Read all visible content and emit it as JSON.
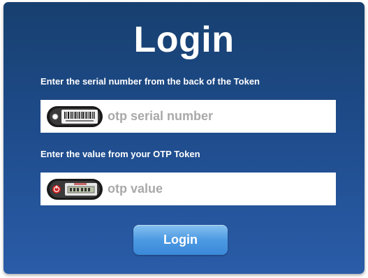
{
  "login_form": {
    "title": "Login",
    "serial": {
      "label": "Enter the serial number from the back of the Token",
      "placeholder": "otp serial number",
      "value": "",
      "icon": "token-barcode-icon"
    },
    "otp": {
      "label": "Enter the value from your OTP Token",
      "placeholder": "otp value",
      "value": "",
      "icon": "token-display-icon"
    },
    "submit_label": "Login"
  },
  "colors": {
    "panel_top": "#17406f",
    "panel_bottom": "#2a5ca8",
    "button": "#4d9ae3",
    "text": "#ffffff",
    "placeholder": "#a9a9a9"
  }
}
